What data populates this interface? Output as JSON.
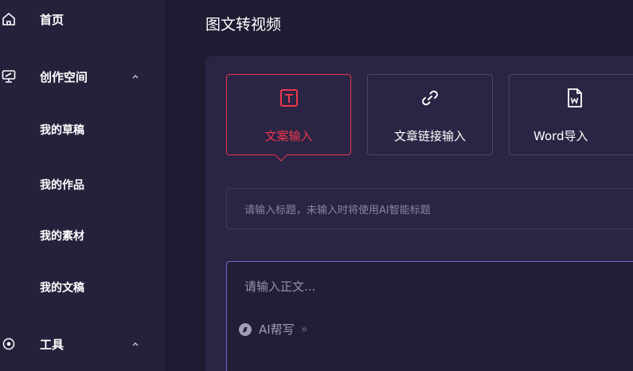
{
  "sidebar": {
    "home": {
      "label": "首页",
      "icon": "home-icon"
    },
    "creation": {
      "label": "创作空间",
      "icon": "monitor-icon"
    },
    "sub_items": [
      {
        "label": "我的草稿"
      },
      {
        "label": "我的作品"
      },
      {
        "label": "我的素材"
      },
      {
        "label": "我的文稿"
      }
    ],
    "tools": {
      "label": "工具",
      "icon": "compass-icon"
    }
  },
  "main": {
    "title": "图文转视频",
    "input_modes": [
      {
        "label": "文案输入",
        "icon": "text-box-icon",
        "active": true
      },
      {
        "label": "文章链接输入",
        "icon": "link-icon",
        "active": false
      },
      {
        "label": "Word导入",
        "icon": "word-doc-icon",
        "active": false
      }
    ],
    "title_placeholder": "请输入标题，未输入时将使用AI智能标题",
    "body_placeholder": "请输入正文...",
    "ai_write": {
      "label": "AI帮写",
      "arrow": "»"
    }
  },
  "colors": {
    "accent": "#e6354f",
    "focus_border": "#6f69c8",
    "sidebar_bg": "#26213b",
    "main_bg": "#1f1b33",
    "panel_bg": "#2a2544"
  }
}
